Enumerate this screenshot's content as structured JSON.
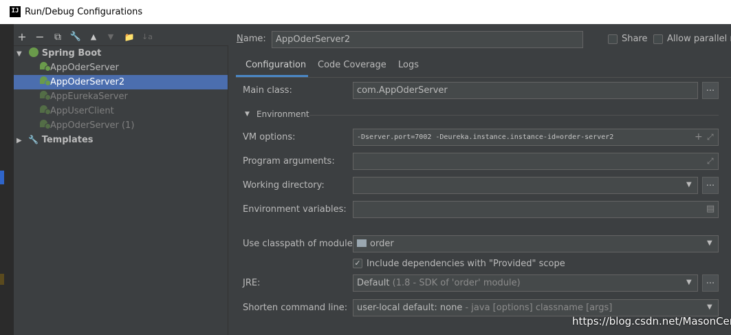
{
  "window": {
    "title": "Run/Debug Configurations",
    "app_icon_text": "IJ"
  },
  "toolbar": {
    "add_icon": "+",
    "remove_icon": "−",
    "copy_icon": "⧉",
    "edit_icon": "🔧",
    "up_icon": "▲",
    "down_icon": "▼",
    "folder_icon": "📁",
    "sort_icon": "↓a"
  },
  "tree": {
    "group": "Spring Boot",
    "items": [
      {
        "label": "AppOderServer"
      },
      {
        "label": "AppOderServer2"
      },
      {
        "label": "AppEurekaServer"
      },
      {
        "label": "AppUserClient"
      },
      {
        "label": "AppOderServer (1)"
      }
    ],
    "templates": "Templates"
  },
  "header": {
    "name_label": "Name:",
    "name_value": "AppOderServer2",
    "share_label": "Share",
    "allow_parallel_label": "Allow parallel ru"
  },
  "tabs": [
    {
      "label": "Configuration"
    },
    {
      "label": "Code Coverage"
    },
    {
      "label": "Logs"
    }
  ],
  "form": {
    "main_class_label": "Main class:",
    "main_class_value": "com.AppOderServer",
    "environment_section": "Environment",
    "vm_options_label": "VM options:",
    "vm_options_value": "-Dserver.port=7002 -Deureka.instance.instance-id=order-server2",
    "program_args_label": "Program arguments:",
    "working_dir_label": "Working directory:",
    "env_vars_label": "Environment variables:",
    "classpath_label": "Use classpath of module:",
    "classpath_value": "order",
    "include_deps_label": "Include dependencies with \"Provided\" scope",
    "jre_label": "JRE:",
    "jre_value": "Default",
    "jre_detail": "(1.8 - SDK of 'order' module)",
    "shorten_label": "Shorten command line:",
    "shorten_value": "user-local default: none",
    "shorten_detail": "- java [options] classname [args]",
    "browse_label": "..."
  },
  "watermark": "https://blog.csdn.net/MasonCen"
}
